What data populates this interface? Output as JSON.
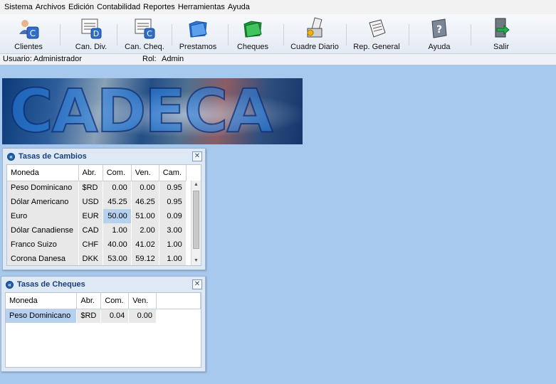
{
  "menu": [
    "Sistema",
    "Archivos",
    "Edición",
    "Contabilidad",
    "Reportes",
    "Herramientas",
    "Ayuda"
  ],
  "toolbar": [
    {
      "label": "Clientes",
      "icon": "clients-icon"
    },
    {
      "label": "Can. Div.",
      "icon": "currency-document-icon"
    },
    {
      "label": "Can. Cheq.",
      "icon": "check-document-icon"
    },
    {
      "label": "Prestamos",
      "icon": "blue-folder-icon"
    },
    {
      "label": "Cheques",
      "icon": "green-folder-icon"
    },
    {
      "label": "Cuadre Diario",
      "icon": "daily-balance-icon"
    },
    {
      "label": "Rep. General",
      "icon": "report-icon"
    },
    {
      "label": "Ayuda",
      "icon": "help-book-icon"
    },
    {
      "label": "Salir",
      "icon": "exit-door-icon"
    }
  ],
  "status": {
    "user_label": "Usuario:",
    "user_value": "Administrador",
    "role_label": "Rol:",
    "role_value": "Admin"
  },
  "banner": {
    "text": "CADECA"
  },
  "exchange_panel": {
    "title": "Tasas de Cambios",
    "columns": [
      "Moneda",
      "Abr.",
      "Com.",
      "Ven.",
      "Cam."
    ],
    "rows": [
      [
        "Peso Dominicano",
        "$RD",
        "0.00",
        "0.00",
        "0.95"
      ],
      [
        "Dólar Americano",
        "USD",
        "45.25",
        "46.25",
        "0.95"
      ],
      [
        "Euro",
        "EUR",
        "50.00",
        "51.00",
        "0.09"
      ],
      [
        "Dólar Canadiense",
        "CAD",
        "1.00",
        "2.00",
        "3.00"
      ],
      [
        "Franco Suizo",
        "CHF",
        "40.00",
        "41.02",
        "1.00"
      ],
      [
        "Corona Danesa",
        "DKK",
        "53.00",
        "59.12",
        "1.00"
      ]
    ]
  },
  "checks_panel": {
    "title": "Tasas de Cheques",
    "columns": [
      "Moneda",
      "Abr.",
      "Com.",
      "Ven."
    ],
    "rows": [
      [
        "Peso Dominicano",
        "$RD",
        "0.04",
        "0.00"
      ]
    ]
  },
  "colors": {
    "desktop": "#a7c9ee",
    "panel_title": "#1b3f7a",
    "selection": "#b6d1ef"
  }
}
